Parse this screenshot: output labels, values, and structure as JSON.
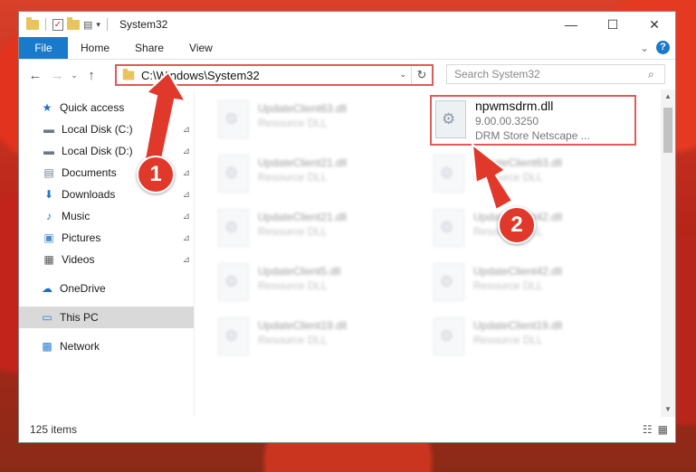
{
  "window": {
    "title": "System32",
    "controls": {
      "minimize": "—",
      "maximize": "☐",
      "close": "✕"
    }
  },
  "ribbon": {
    "tabs": [
      "File",
      "Home",
      "Share",
      "View"
    ],
    "expand_glyph": "⌄",
    "help_glyph": "?"
  },
  "nav": {
    "back": "←",
    "forward": "→",
    "recent": "⌄",
    "up": "↑"
  },
  "address": {
    "path": "C:\\Windows\\System32",
    "dropdown_glyph": "⌄",
    "refresh_glyph": "↻"
  },
  "search": {
    "placeholder": "Search System32",
    "icon": "⌕"
  },
  "sidebar": {
    "items": [
      {
        "label": "Quick access",
        "icon": "★",
        "color": "#1f6fc4"
      },
      {
        "label": "Local Disk (C:)",
        "icon": "▬",
        "color": "#6b7a88",
        "pinned": true
      },
      {
        "label": "Local Disk (D:)",
        "icon": "▬",
        "color": "#6b7a88",
        "pinned": true
      },
      {
        "label": "Documents",
        "icon": "▤",
        "color": "#6e7f92",
        "pinned": true
      },
      {
        "label": "Downloads",
        "icon": "⬇",
        "color": "#1f78d1",
        "pinned": true
      },
      {
        "label": "Music",
        "icon": "♪",
        "color": "#1f78d1",
        "pinned": true
      },
      {
        "label": "Pictures",
        "icon": "▣",
        "color": "#4b8ec9",
        "pinned": true
      },
      {
        "label": "Videos",
        "icon": "▦",
        "color": "#555",
        "pinned": true
      },
      {
        "label": "OneDrive",
        "icon": "☁",
        "color": "#1f6fc4"
      },
      {
        "label": "This PC",
        "icon": "▭",
        "color": "#2a7fd0"
      },
      {
        "label": "Network",
        "icon": "▩",
        "color": "#2a7fd0"
      }
    ],
    "pin_glyph": "📌"
  },
  "files": [
    {
      "name": "UpdateClient63.dll",
      "sub": "Resource DLL"
    },
    {
      "name": "npwmsdrm.dll",
      "sub": "9.00.00.3250",
      "sub2": "DRM Store Netscape ..."
    },
    {
      "name": "UpdateClient21.dll",
      "sub": "Resource DLL"
    },
    {
      "name": "UpdateClient63.dll",
      "sub": "Resource DLL"
    },
    {
      "name": "UpdateClient21.dll",
      "sub": "Resource DLL"
    },
    {
      "name": "UpdateClient42.dll",
      "sub": "Resource DLL"
    },
    {
      "name": "UpdateClient5.dll",
      "sub": "Resource DLL"
    },
    {
      "name": "UpdateClient42.dll",
      "sub": "Resource DLL"
    },
    {
      "name": "UpdateClient19.dll",
      "sub": "Resource DLL"
    },
    {
      "name": "UpdateClient19.dll",
      "sub": "Resource DLL"
    }
  ],
  "status": {
    "count": "125 items",
    "details_view": "☷",
    "tiles_view": "▦"
  },
  "annotations": {
    "badge1": "1",
    "badge2": "2",
    "color": "#e0392b"
  },
  "scroll": {
    "up": "▲",
    "down": "▼"
  }
}
